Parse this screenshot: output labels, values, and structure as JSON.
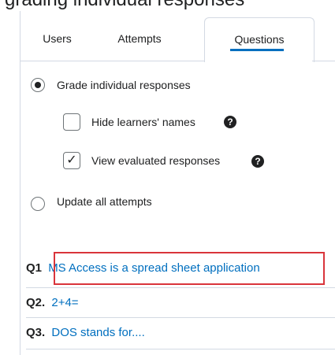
{
  "header": {
    "clipped_title": "grading individual responses"
  },
  "tabs": [
    {
      "label": "Users",
      "active": false
    },
    {
      "label": "Attempts",
      "active": false
    },
    {
      "label": "Questions",
      "active": true
    }
  ],
  "grading_mode": {
    "option_individual": {
      "label": "Grade individual responses",
      "selected": true
    },
    "hide_names": {
      "label": "Hide learners' names",
      "checked": false
    },
    "view_evaluated": {
      "label": "View evaluated responses",
      "checked": true
    },
    "option_update_all": {
      "label": "Update all attempts",
      "selected": false
    }
  },
  "questions": [
    {
      "number": "Q1",
      "text": "MS Access is a spread sheet application",
      "highlighted": true
    },
    {
      "number": "Q2.",
      "text": "2+4="
    },
    {
      "number": "Q3.",
      "text": "DOS stands for...."
    }
  ],
  "colors": {
    "accent": "#006fbf",
    "highlight": "#d9343b",
    "border": "#d3d9e3"
  },
  "icons": {
    "help": "question-circle-icon"
  }
}
